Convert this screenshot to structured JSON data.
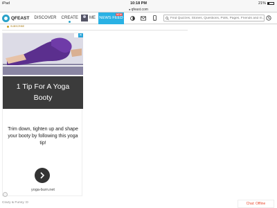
{
  "status_bar": {
    "device": "iPad",
    "time": "10:18 PM",
    "battery": "21%",
    "battery_level": 0.21
  },
  "browser": {
    "url": "qfeast.com"
  },
  "navbar": {
    "logo": "QFEAST",
    "links": [
      "DISCOVER",
      "CREATE"
    ],
    "me_label": "ME",
    "news_feed": "NEWS FEED",
    "news_feed_badge": "NEW",
    "search_placeholder": "Find Quizzes, Stories, Questions, Polls, Pages, Friends and m..."
  },
  "sub_strip": {
    "tag": "SUBSCRIBE"
  },
  "ad": {
    "title": "1 Tip For A Yoga Booty",
    "body": "Trim down, tighten up and shape your booty by following this yoga tip!",
    "domain": "yoga-burn.net",
    "close_label": "✕"
  },
  "footer": {
    "text": "Crazy & Funny :D",
    "chat_status": "Chat: Offline"
  },
  "colors": {
    "accent": "#29b1e4",
    "ad_title_bg": "#3b3b3b",
    "chat_offline": "#e8492f"
  }
}
